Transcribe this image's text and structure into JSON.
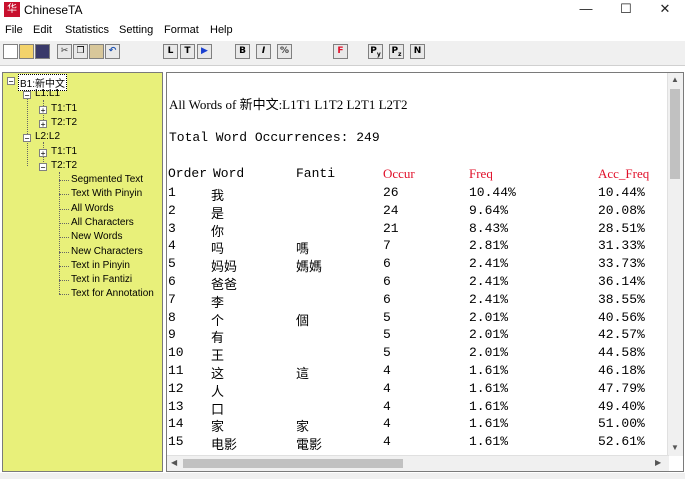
{
  "window": {
    "title": "ChineseTA",
    "icon_text": "华",
    "minimize": "—",
    "maximize": "☐",
    "close": "✕"
  },
  "menu": [
    "File",
    "Edit",
    "Statistics",
    "Setting",
    "Format",
    "Help"
  ],
  "toolbar": {
    "new": "",
    "open": "",
    "save": "",
    "cut": "",
    "copy": "",
    "paste": "",
    "undo": "",
    "l": "L",
    "t": "T",
    "play": "▶",
    "bold": "B",
    "italic": "I",
    "tag": "%",
    "font": "F",
    "py": "P",
    "pz": "P",
    "n": "N"
  },
  "tree": {
    "root": "B1:新中文",
    "l1": "L1:L1",
    "l1_t1": "T1:T1",
    "l1_t2": "T2:T2",
    "l2": "L2:L2",
    "l2_t1": "T1:T1",
    "l2_t2": "T2:T2",
    "leaves": [
      "Segmented Text",
      "Text With Pinyin",
      "All Words",
      "All Characters",
      "New Words",
      "New Characters",
      "Text in Pinyin",
      "Text in Fantizi",
      "Text for Annotation"
    ]
  },
  "content": {
    "heading": "All Words of 新中文:L1T1  L1T2  L2T1  L2T2",
    "total": "Total Word Occurrences: 249",
    "columns": {
      "order": "Order",
      "word": "Word",
      "fanti": "Fanti",
      "occur": "Occur",
      "freq": "Freq",
      "acc_freq": "Acc_Freq"
    },
    "header_red": "#e0102a",
    "rows": [
      {
        "order": "1",
        "word": "我",
        "fanti": "",
        "occur": "26",
        "freq": "10.44%",
        "acc": "10.44%"
      },
      {
        "order": "2",
        "word": "是",
        "fanti": "",
        "occur": "24",
        "freq": "9.64%",
        "acc": "20.08%"
      },
      {
        "order": "3",
        "word": "你",
        "fanti": "",
        "occur": "21",
        "freq": "8.43%",
        "acc": "28.51%"
      },
      {
        "order": "4",
        "word": "吗",
        "fanti": "嗎",
        "occur": "7",
        "freq": "2.81%",
        "acc": "31.33%"
      },
      {
        "order": "5",
        "word": "妈妈",
        "fanti": "媽媽",
        "occur": "6",
        "freq": "2.41%",
        "acc": "33.73%"
      },
      {
        "order": "6",
        "word": "爸爸",
        "fanti": "",
        "occur": "6",
        "freq": "2.41%",
        "acc": "36.14%"
      },
      {
        "order": "7",
        "word": "李",
        "fanti": "",
        "occur": "6",
        "freq": "2.41%",
        "acc": "38.55%"
      },
      {
        "order": "8",
        "word": "个",
        "fanti": "個",
        "occur": "5",
        "freq": "2.01%",
        "acc": "40.56%"
      },
      {
        "order": "9",
        "word": "有",
        "fanti": "",
        "occur": "5",
        "freq": "2.01%",
        "acc": "42.57%"
      },
      {
        "order": "10",
        "word": "王",
        "fanti": "",
        "occur": "5",
        "freq": "2.01%",
        "acc": "44.58%"
      },
      {
        "order": "11",
        "word": "这",
        "fanti": "這",
        "occur": "4",
        "freq": "1.61%",
        "acc": "46.18%"
      },
      {
        "order": "12",
        "word": "人",
        "fanti": "",
        "occur": "4",
        "freq": "1.61%",
        "acc": "47.79%"
      },
      {
        "order": "13",
        "word": "口",
        "fanti": "",
        "occur": "4",
        "freq": "1.61%",
        "acc": "49.40%"
      },
      {
        "order": "14",
        "word": "家",
        "fanti": "家",
        "occur": "4",
        "freq": "1.61%",
        "acc": "51.00%"
      },
      {
        "order": "15",
        "word": "电影",
        "fanti": "電影",
        "occur": "4",
        "freq": "1.61%",
        "acc": "52.61%"
      }
    ]
  }
}
